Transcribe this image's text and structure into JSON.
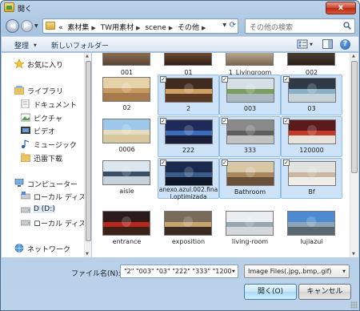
{
  "window": {
    "title": "開く",
    "close": "x"
  },
  "address": {
    "overflow": "«",
    "crumbs": [
      "素材集",
      "TW用素材",
      "scene",
      "その他"
    ]
  },
  "search": {
    "placeholder": "その他の検索"
  },
  "toolbar": {
    "organize": "整理",
    "new_folder": "新しいフォルダー",
    "help": "?"
  },
  "nav": {
    "favorites": "お気に入り",
    "libraries": "ライブラリ",
    "documents": "ドキュメント",
    "pictures": "ピクチャ",
    "videos": "ビデオ",
    "music": "ミュージック",
    "thunder": "迅雷下载",
    "computer": "コンピューター",
    "local_c": "ローカル ディス",
    "drive_d": "D (D:)",
    "local_e": "ローカル ディス",
    "network": "ネットワーク"
  },
  "files": [
    {
      "label": "001",
      "selected": false,
      "checked": false,
      "colors": [
        "#c9a98a",
        "#9a7a5a",
        "#6e4e38"
      ]
    },
    {
      "label": "01",
      "selected": false,
      "checked": false,
      "colors": [
        "#6a4a3a",
        "#b58a5a",
        "#3e2a1e"
      ]
    },
    {
      "label": "1_Livingroom",
      "selected": false,
      "checked": false,
      "colors": [
        "#d6c8b2",
        "#a58e72",
        "#7a6650"
      ]
    },
    {
      "label": "002",
      "selected": false,
      "checked": false,
      "colors": [
        "#5a4a3e",
        "#8a6a4a",
        "#3a2a22"
      ]
    },
    {
      "label": "02",
      "selected": false,
      "checked": false,
      "colors": [
        "#e6d2a8",
        "#c79a62",
        "#a67a4a"
      ]
    },
    {
      "label": "2",
      "selected": true,
      "checked": true,
      "colors": [
        "#3e2a1e",
        "#d0a060",
        "#5a3a22"
      ]
    },
    {
      "label": "003",
      "selected": true,
      "checked": true,
      "colors": [
        "#d6dee6",
        "#7aa060",
        "#aab8c2"
      ]
    },
    {
      "label": "03",
      "selected": true,
      "checked": true,
      "colors": [
        "#2e3a46",
        "#8ab0c8",
        "#c6d2da"
      ]
    },
    {
      "label": "0006",
      "selected": false,
      "checked": false,
      "colors": [
        "#9ec8ea",
        "#e6dcc2",
        "#d8c8a0"
      ]
    },
    {
      "label": "222",
      "selected": true,
      "checked": true,
      "colors": [
        "#1e2a5a",
        "#3a6ab8",
        "#1a1e3a"
      ]
    },
    {
      "label": "333",
      "selected": true,
      "checked": true,
      "colors": [
        "#8a8a8a",
        "#5e5e5e",
        "#c2c2c2"
      ]
    },
    {
      "label": "120000",
      "selected": true,
      "checked": true,
      "colors": [
        "#5a1a1a",
        "#c23a2a",
        "#e8e2da"
      ]
    },
    {
      "label": "aisle",
      "selected": false,
      "checked": false,
      "colors": [
        "#dce6ee",
        "#3a4e66",
        "#c8d2da"
      ]
    },
    {
      "label": "anexo.azul.002.final.optimizada",
      "selected": true,
      "checked": true,
      "colors": [
        "#1a2a4e",
        "#3a5a8a",
        "#0e162a"
      ]
    },
    {
      "label": "Bathroom",
      "selected": true,
      "checked": true,
      "colors": [
        "#d8c8a8",
        "#a88860",
        "#6a5038"
      ]
    },
    {
      "label": "Bf",
      "selected": true,
      "checked": true,
      "colors": [
        "#e2e2de",
        "#c8b8a0",
        "#f0eee8"
      ]
    },
    {
      "label": "entrance",
      "selected": false,
      "checked": false,
      "colors": [
        "#2a1a1a",
        "#b8261e",
        "#3a2218"
      ]
    },
    {
      "label": "exposition",
      "selected": false,
      "checked": false,
      "colors": [
        "#7a6a5a",
        "#c8a46e",
        "#3a2a22"
      ]
    },
    {
      "label": "living-room",
      "selected": false,
      "checked": false,
      "colors": [
        "#e8eef2",
        "#9aa6ae",
        "#d2d8dc"
      ]
    },
    {
      "label": "lujiazui",
      "selected": false,
      "checked": false,
      "colors": [
        "#4e8ad2",
        "#8aa6b8",
        "#5a6670"
      ]
    }
  ],
  "bottom": {
    "filename_label": "ファイル名(N):",
    "filename_value": "\"2\" \"003\" \"03\" \"222\" \"333\" \"1200",
    "filetype": "Image Files(.jpg,.bmp,.gif)",
    "open": "開く(O)",
    "cancel": "キャンセル"
  }
}
